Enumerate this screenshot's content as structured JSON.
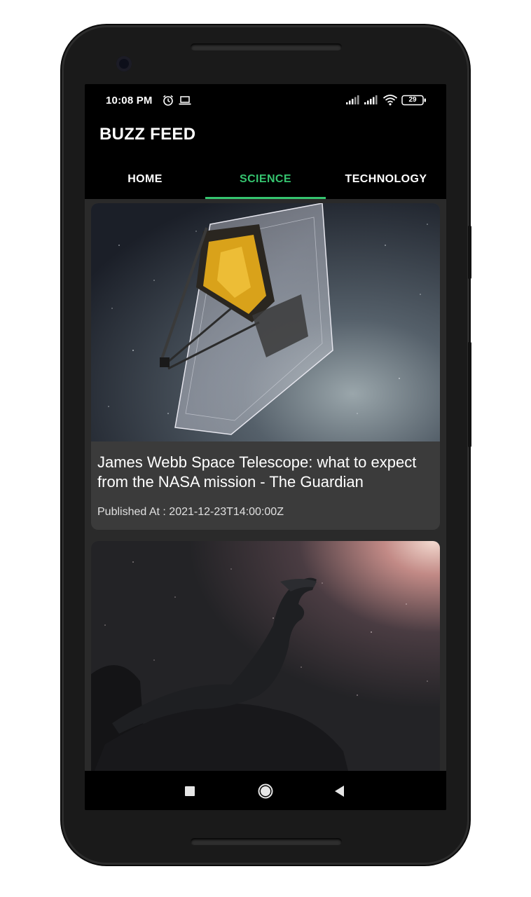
{
  "status_bar": {
    "time": "10:08 PM",
    "icons": [
      "alarm-icon",
      "laptop-icon",
      "signal-icon",
      "signal-icon",
      "wifi-icon",
      "battery-icon"
    ],
    "battery_level": "29"
  },
  "app": {
    "title": "BUZZ FEED"
  },
  "tabs": [
    {
      "label": "HOME",
      "active": false
    },
    {
      "label": "SCIENCE",
      "active": true
    },
    {
      "label": "TECHNOLOGY",
      "active": false
    }
  ],
  "colors": {
    "accent": "#35c46f",
    "background": "#000000",
    "feed_background": "#2a2a2a",
    "card_background": "#3b3b3b"
  },
  "articles": [
    {
      "title": "James Webb Space Telescope: what to expect from the NASA mission - The Guardian",
      "published": "Published At : 2021-12-23T14:00:00Z",
      "image": "telescope-image"
    },
    {
      "title": "",
      "published": "",
      "image": "dinosaur-image"
    }
  ],
  "nav_bar": {
    "buttons": [
      "recents-icon",
      "home-icon",
      "back-icon"
    ]
  }
}
